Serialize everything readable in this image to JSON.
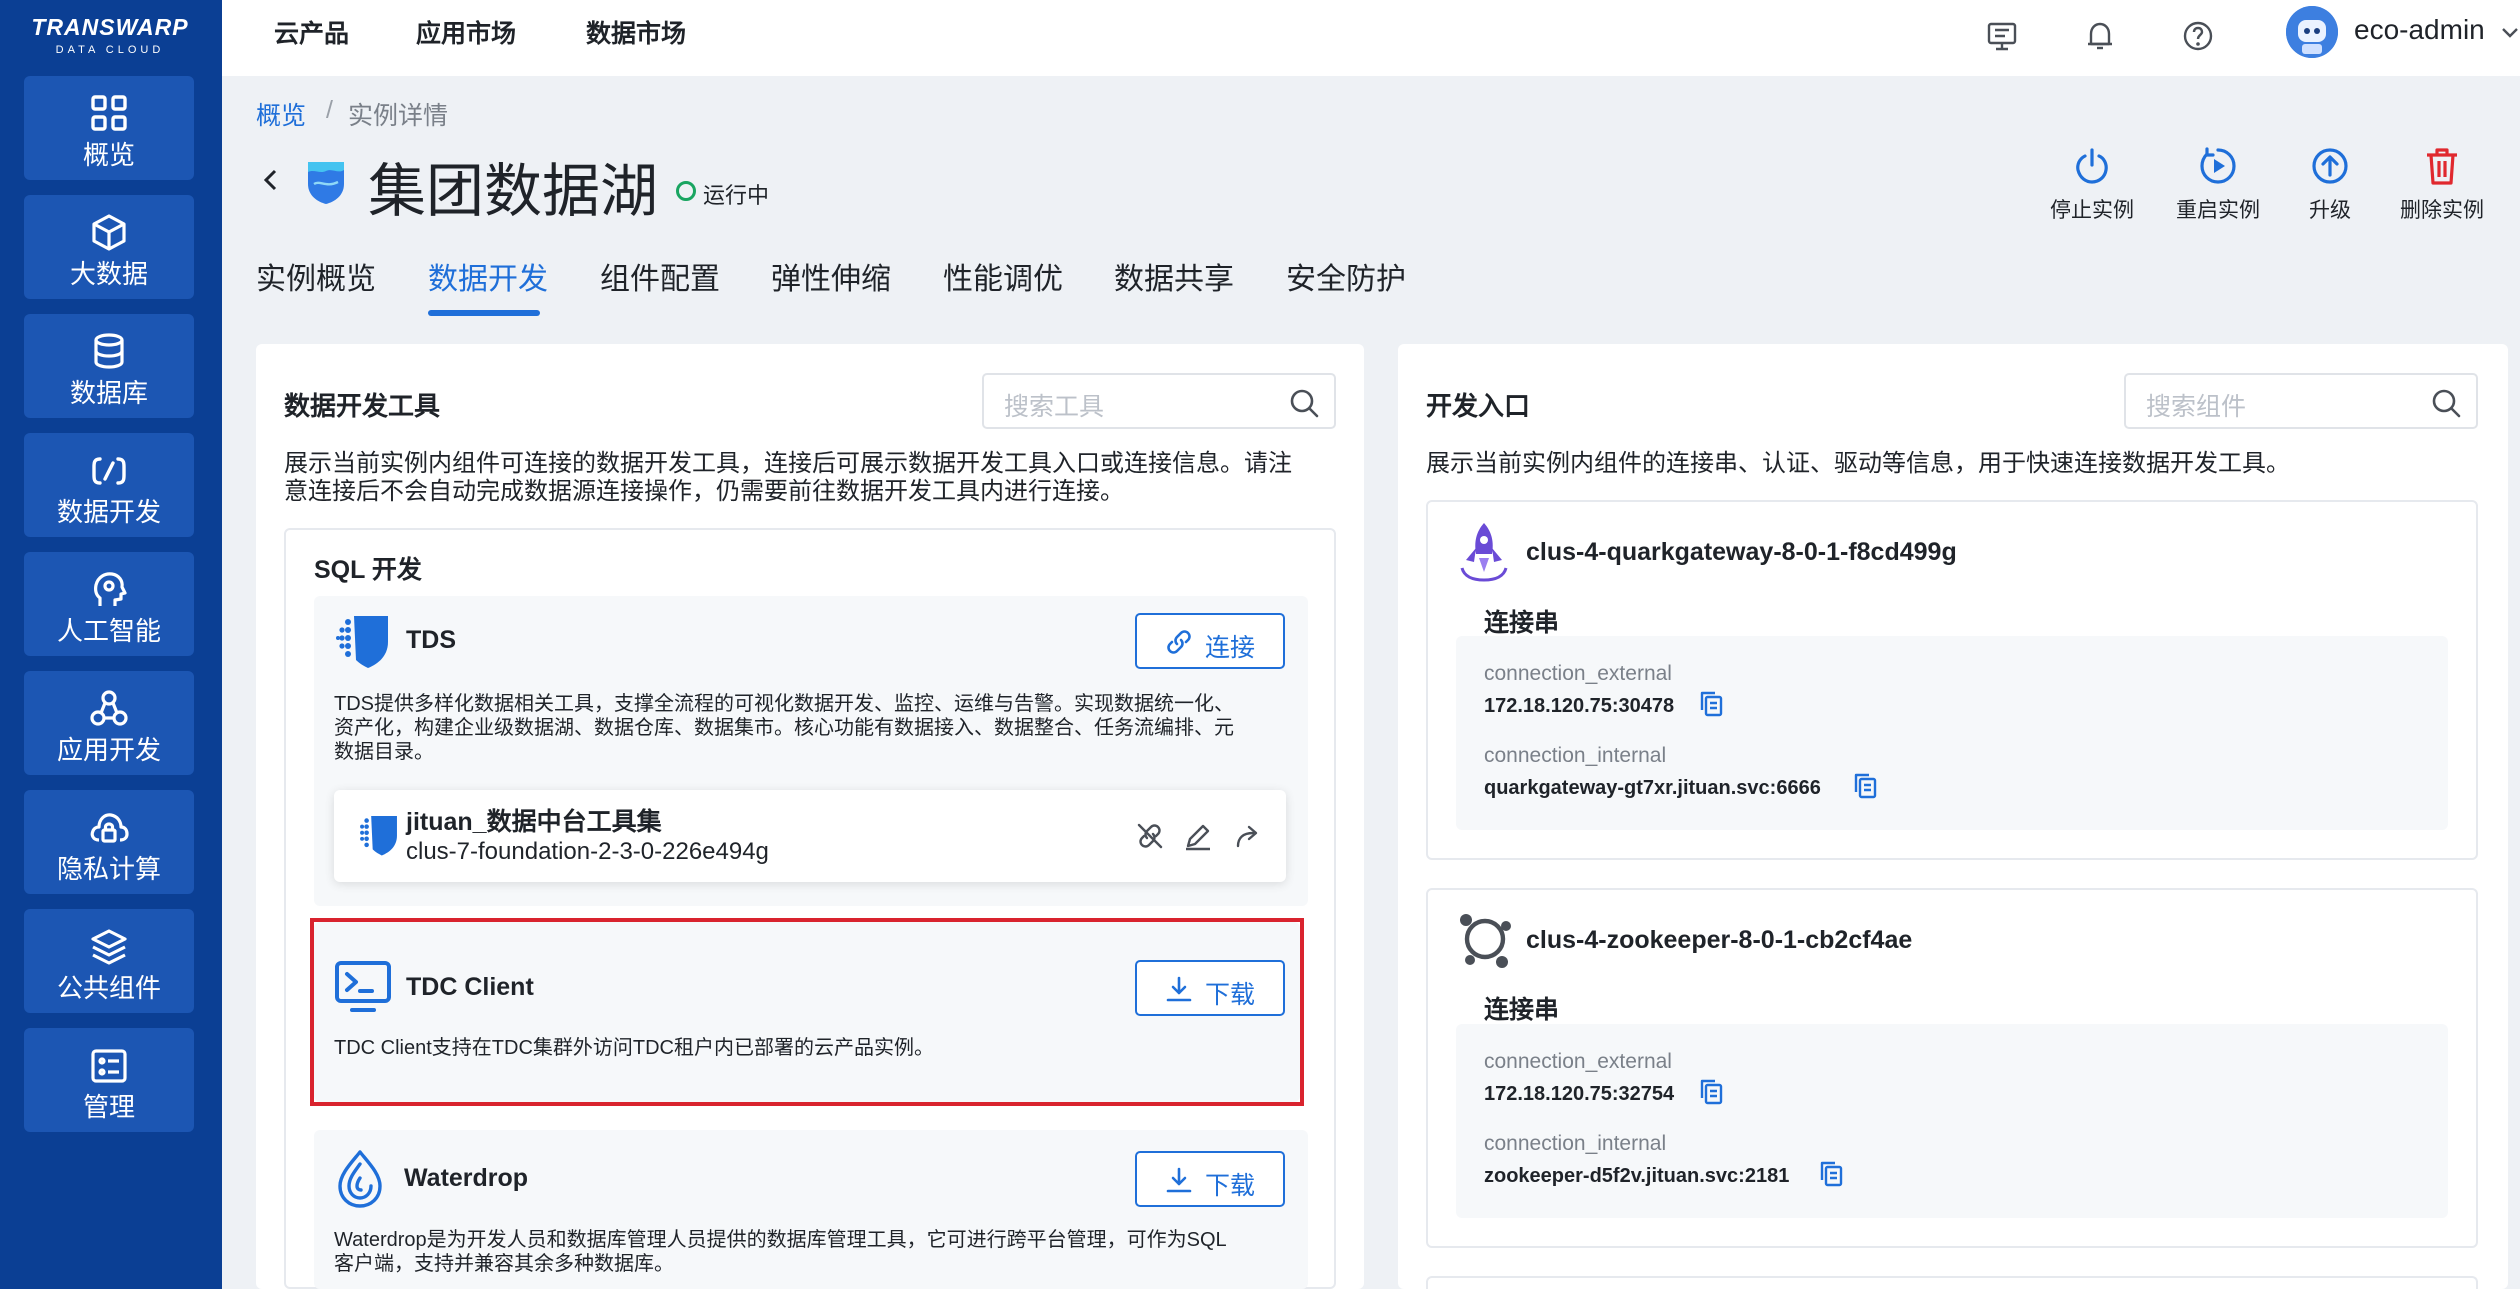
{
  "brand": {
    "logo_text": "TRANSWARP",
    "logo_sub": "DATA CLOUD"
  },
  "sidebar": {
    "items": [
      {
        "label": "概览",
        "icon": "grid-icon"
      },
      {
        "label": "大数据",
        "icon": "cube-icon"
      },
      {
        "label": "数据库",
        "icon": "database-icon"
      },
      {
        "label": "数据开发",
        "icon": "code-icon"
      },
      {
        "label": "人工智能",
        "icon": "brain-icon"
      },
      {
        "label": "应用开发",
        "icon": "nodes-icon"
      },
      {
        "label": "隐私计算",
        "icon": "cloud-lock-icon"
      },
      {
        "label": "公共组件",
        "icon": "layers-icon"
      },
      {
        "label": "管理",
        "icon": "id-card-icon"
      }
    ]
  },
  "topnav": {
    "items": [
      "云产品",
      "应用市场",
      "数据市场"
    ],
    "user": "eco-admin"
  },
  "breadcrumb": {
    "root": "概览",
    "sep": "/",
    "current": "实例详情"
  },
  "header": {
    "title": "集团数据湖",
    "status": "运行中"
  },
  "actions": [
    "停止实例",
    "重启实例",
    "升级",
    "删除实例"
  ],
  "tabs": [
    "实例概览",
    "数据开发",
    "组件配置",
    "弹性伸缩",
    "性能调优",
    "数据共享",
    "安全防护"
  ],
  "active_tab": "数据开发",
  "tools_panel": {
    "title": "数据开发工具",
    "search_placeholder": "搜索工具",
    "desc_line1": "展示当前实例内组件可连接的数据开发工具，连接后可展示数据开发工具入口或连接信息。请注",
    "desc_line2": "意连接后不会自动完成数据源连接操作，仍需要前往数据开发工具内进行连接。",
    "group_title": "SQL 开发",
    "tools": [
      {
        "name": "TDS",
        "button": "连接",
        "desc_line1": "TDS提供多样化数据相关工具，支撑全流程的可视化数据开发、监控、运维与告警。实现数据统一化、",
        "desc_line2": "资产化，构建企业级数据湖、数据仓库、数据集市。核心功能有数据接入、数据整合、任务流编排、元",
        "desc_line3": "数据目录。"
      },
      {
        "name": "TDC Client",
        "button": "下载",
        "desc_line1": "TDC Client支持在TDC集群外访问TDC租户内已部署的云产品实例。"
      },
      {
        "name": "Waterdrop",
        "button": "下载",
        "desc_line1": "Waterdrop是为开发人员和数据库管理人员提供的数据库管理工具，它可进行跨平台管理，可作为SQL",
        "desc_line2": "客户端，支持并兼容其余多种数据库。"
      }
    ],
    "connected": {
      "name": "jituan_数据中台工具集",
      "id": "clus-7-foundation-2-3-0-226e494g"
    }
  },
  "entry_panel": {
    "title": "开发入口",
    "search_placeholder": "搜索组件",
    "desc": "展示当前实例内组件的连接串、认证、驱动等信息，用于快速连接数据开发工具。",
    "entries": [
      {
        "name": "clus-4-quarkgateway-8-0-1-f8cd499g",
        "section": "连接串",
        "ext_key": "connection_external",
        "ext_val": "172.18.120.75:30478",
        "int_key": "connection_internal",
        "int_val": "quarkgateway-gt7xr.jituan.svc:6666"
      },
      {
        "name": "clus-4-zookeeper-8-0-1-cb2cf4ae",
        "section": "连接串",
        "ext_key": "connection_external",
        "ext_val": "172.18.120.75:32754",
        "int_key": "connection_internal",
        "int_val": "zookeeper-d5f2v.jituan.svc:2181"
      }
    ]
  },
  "colors": {
    "sidebar": "#0b3f94",
    "sidebar_item": "#1c56b3",
    "primary": "#1f6fd9",
    "danger": "#e0282e",
    "running": "#19a561",
    "highlight": "#d9232e"
  }
}
